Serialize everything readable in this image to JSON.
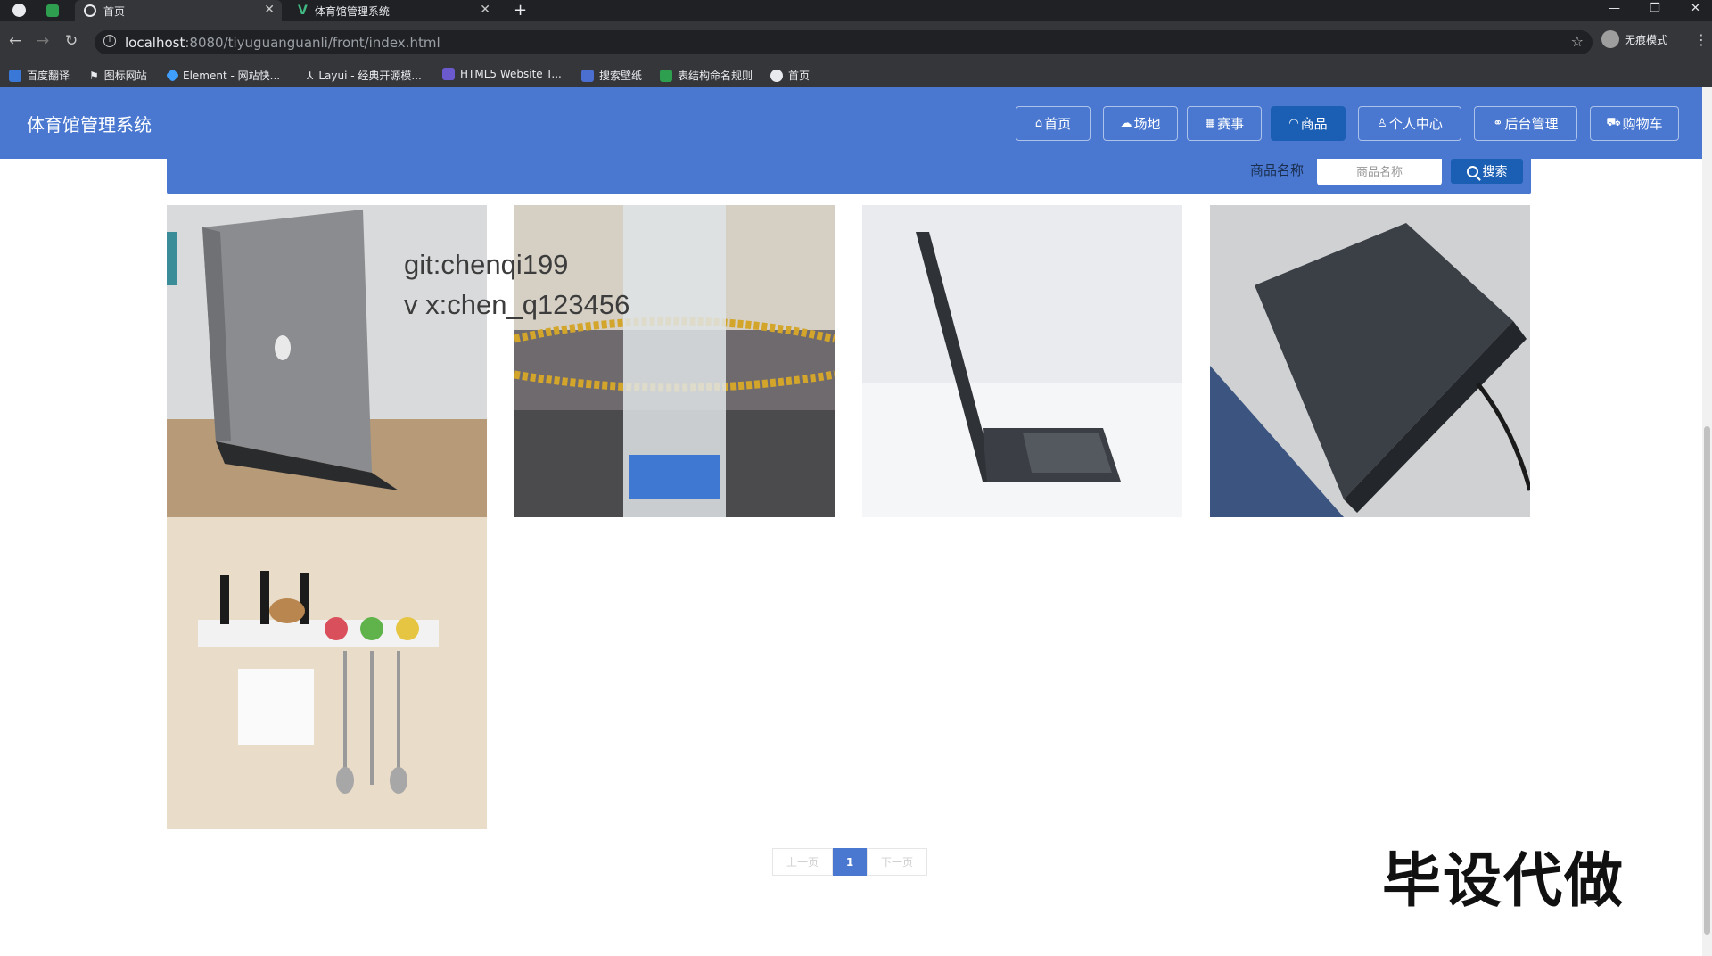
{
  "browser": {
    "tabs": [
      {
        "label": "首页",
        "active": true
      },
      {
        "label": "体育馆管理系统",
        "active": false
      }
    ],
    "new_tab_label": "+",
    "url_host": "localhost",
    "url_rest": ":8080/tiyuguanguanli/front/index.html",
    "incognito_label": "无痕模式",
    "bookmarks": [
      {
        "label": "百度翻译",
        "color": "#3a78d8"
      },
      {
        "label": "图标网站",
        "color": "#e8eaed"
      },
      {
        "label": "Element - 网站快...",
        "color": "#409eff"
      },
      {
        "label": "Layui - 经典开源模...",
        "color": "#e8eaed"
      },
      {
        "label": "HTML5 Website T...",
        "color": "#6a5acd"
      },
      {
        "label": "搜索壁纸",
        "color": "#4a6fd0"
      },
      {
        "label": "表结构命名规则",
        "color": "#2e9e4f"
      },
      {
        "label": "首页",
        "color": "#e8eaed"
      }
    ]
  },
  "header": {
    "brand": "体育馆管理系统",
    "brand_color": "#4a78d0",
    "active_color": "#1b5fb4",
    "nav": [
      {
        "icon": "⌂",
        "label": "首页",
        "active": false
      },
      {
        "icon": "☁",
        "label": "场地",
        "active": false
      },
      {
        "icon": "▦",
        "label": "赛事",
        "active": false
      },
      {
        "icon": "◠",
        "label": "商品",
        "active": true
      },
      {
        "icon": "♙",
        "label": "个人中心",
        "active": false
      },
      {
        "icon": "⚭",
        "label": "后台管理",
        "active": false
      },
      {
        "icon": "⛟",
        "label": "购物车",
        "active": false
      }
    ]
  },
  "search": {
    "label": "商品名称",
    "placeholder": "商品名称",
    "value": "",
    "button_label": "搜索"
  },
  "products": [
    {
      "name": "laptop-gray"
    },
    {
      "name": "gold-necklace"
    },
    {
      "name": "laptop-side"
    },
    {
      "name": "laptop-dark"
    },
    {
      "name": "kitchen-rack"
    }
  ],
  "overlay": {
    "line1": "git:chenqi199",
    "line2": "v x:chen_q123456",
    "stamp": "毕设代做"
  },
  "pager": {
    "prev": "上一页",
    "current": "1",
    "next": "下一页"
  }
}
